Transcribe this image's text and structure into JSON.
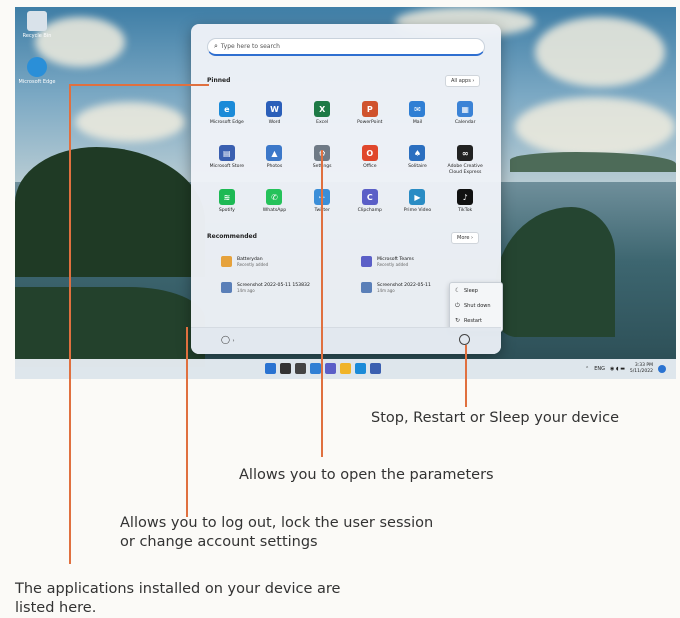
{
  "desktop": {
    "icons": [
      {
        "label": "Recycle Bin",
        "icon": "recycle-bin-icon",
        "color": "#d9e2ea"
      },
      {
        "label": "Microsoft Edge",
        "icon": "edge-icon",
        "color": "#2a8fd8"
      }
    ]
  },
  "start_menu": {
    "search_placeholder": "Type here to search",
    "pinned_title": "Pinned",
    "all_apps_label": "All apps  ›",
    "pinned_apps": [
      {
        "label": "Microsoft Edge",
        "icon": "edge-icon",
        "glyph": "e",
        "color": "#1b8bd8"
      },
      {
        "label": "Word",
        "icon": "word-icon",
        "glyph": "W",
        "color": "#2b5fb9"
      },
      {
        "label": "Excel",
        "icon": "excel-icon",
        "glyph": "X",
        "color": "#1d7a45"
      },
      {
        "label": "PowerPoint",
        "icon": "powerpoint-icon",
        "glyph": "P",
        "color": "#d0532d"
      },
      {
        "label": "Mail",
        "icon": "mail-icon",
        "glyph": "✉",
        "color": "#2f7fd4"
      },
      {
        "label": "Calendar",
        "icon": "calendar-icon",
        "glyph": "▦",
        "color": "#3b83d6"
      },
      {
        "label": "Microsoft Store",
        "icon": "store-icon",
        "glyph": "▤",
        "color": "#3a5fb0"
      },
      {
        "label": "Photos",
        "icon": "photos-icon",
        "glyph": "▲",
        "color": "#3c78c9"
      },
      {
        "label": "Settings",
        "icon": "gear-icon",
        "glyph": "⚙",
        "color": "#6f7a86"
      },
      {
        "label": "Office",
        "icon": "office-icon",
        "glyph": "O",
        "color": "#e0472c"
      },
      {
        "label": "Solitaire",
        "icon": "solitaire-icon",
        "glyph": "♠",
        "color": "#2b6fc0"
      },
      {
        "label": "Adobe Creative Cloud Express",
        "icon": "adobe-icon",
        "glyph": "∞",
        "color": "#222222"
      },
      {
        "label": "Spotify",
        "icon": "spotify-icon",
        "glyph": "≋",
        "color": "#1db954"
      },
      {
        "label": "WhatsApp",
        "icon": "whatsapp-icon",
        "glyph": "✆",
        "color": "#25c25a"
      },
      {
        "label": "Twitter",
        "icon": "twitter-icon",
        "glyph": "✈",
        "color": "#3b8ed8"
      },
      {
        "label": "Clipchamp",
        "icon": "clipchamp-icon",
        "glyph": "C",
        "color": "#5b5fc7"
      },
      {
        "label": "Prime Video",
        "icon": "prime-video-icon",
        "glyph": "▶",
        "color": "#2a8cc4"
      },
      {
        "label": "TikTok",
        "icon": "tiktok-icon",
        "glyph": "♪",
        "color": "#111111"
      }
    ],
    "recommended_title": "Recommended",
    "more_label": "More  ›",
    "recommended": [
      {
        "title": "Batterydan",
        "sub": "Recently added",
        "icon": "app-icon",
        "color": "#e6a23c"
      },
      {
        "title": "Microsoft Teams",
        "sub": "Recently added",
        "icon": "teams-icon",
        "color": "#5b5fc7"
      },
      {
        "title": "Screenshot 2022-05-11 153832",
        "sub": "14m ago",
        "icon": "image-file-icon",
        "color": "#5a7fb8"
      },
      {
        "title": "Screenshot 2022-05-11",
        "sub": "14m ago",
        "icon": "image-file-icon",
        "color": "#5a7fb8"
      }
    ],
    "power_menu": [
      {
        "label": "Sleep",
        "icon": "sleep-icon",
        "glyph": "☾"
      },
      {
        "label": "Shut down",
        "icon": "power-icon",
        "glyph": "⏻"
      },
      {
        "label": "Restart",
        "icon": "restart-icon",
        "glyph": "↻"
      }
    ]
  },
  "taskbar": {
    "icons": [
      {
        "name": "start-icon",
        "color": "#2a73d1"
      },
      {
        "name": "search-icon",
        "color": "#333333"
      },
      {
        "name": "task-view-icon",
        "color": "#444444"
      },
      {
        "name": "widgets-icon",
        "color": "#2f7fd4"
      },
      {
        "name": "chat-icon",
        "color": "#5b5fc7"
      },
      {
        "name": "file-explorer-icon",
        "color": "#f0b429"
      },
      {
        "name": "edge-icon",
        "color": "#1b8bd8"
      },
      {
        "name": "store-icon",
        "color": "#3a5fb0"
      }
    ],
    "lang": "ENG",
    "time": "3:33 PM",
    "date": "5/11/2022"
  },
  "callouts": {
    "power": "Stop, Restart or Sleep your device",
    "settings": "Allows you to open the parameters",
    "account_line1": "Allows you to log out, lock the user session",
    "account_line2": "or change account settings",
    "apps_line1": "The applications installed on your device are",
    "apps_line2": "listed here."
  }
}
